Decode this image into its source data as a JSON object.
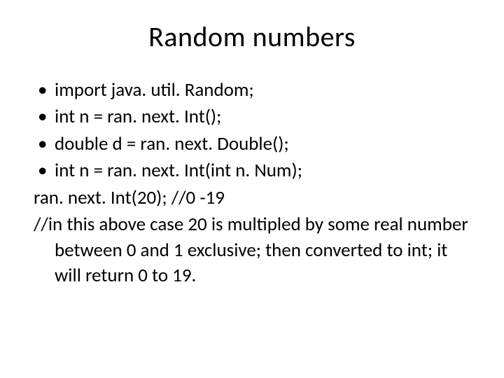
{
  "title": "Random numbers",
  "bullets": [
    "import java. util. Random;",
    "int n = ran. next. Int();",
    "double d = ran. next. Double();",
    "int n = ran. next. Int(int n. Num);"
  ],
  "lines": [
    "ran. next. Int(20); //0 -19",
    "//in this above case 20 is multipled by some real number between 0 and 1 exclusive; then converted to int;  it will return 0 to 19."
  ]
}
